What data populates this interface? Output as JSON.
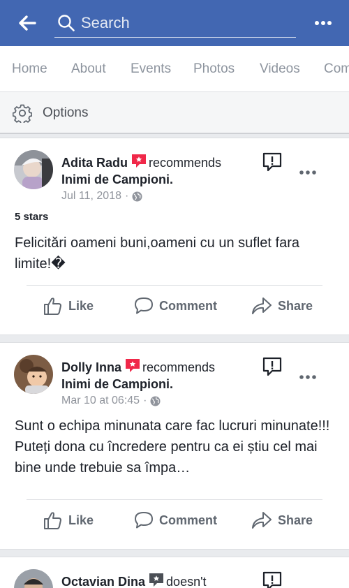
{
  "header": {
    "search_placeholder": "Search"
  },
  "tabs": [
    "Home",
    "About",
    "Events",
    "Photos",
    "Videos",
    "Com"
  ],
  "options": {
    "label": "Options"
  },
  "posts": [
    {
      "author": "Adita Radu",
      "verb": "recommends",
      "page": "Inimi de Campioni",
      "page_suffix": ".",
      "timestamp": "Jul 11, 2018",
      "meta_sep": "·",
      "rating": "5 stars",
      "text": "Felicitări oameni buni,oameni cu un suflet fara limite!�",
      "actions": {
        "like": "Like",
        "comment": "Comment",
        "share": "Share"
      }
    },
    {
      "author": "Dolly Inna",
      "verb": "recommends",
      "page": "Inimi de Campioni",
      "page_suffix": ".",
      "timestamp": "Mar 10 at 06:45",
      "meta_sep": "·",
      "text": "Sunt o echipa minunata care fac lucruri minunate!!! Puteți dona cu încredere pentru ca ei știu cel mai bine unde trebuie sa împa…",
      "actions": {
        "like": "Like",
        "comment": "Comment",
        "share": "Share"
      }
    },
    {
      "author": "Octavian Dina",
      "verb": "doesn't"
    }
  ]
}
